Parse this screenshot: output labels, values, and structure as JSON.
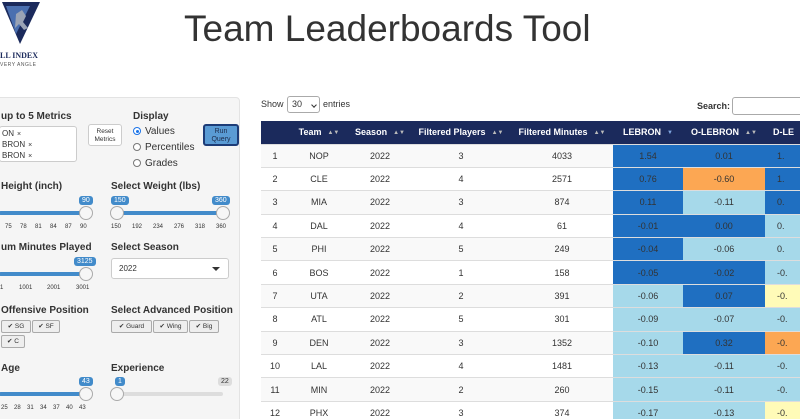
{
  "header": {
    "title": "Team Leaderboards Tool",
    "logo_title": "LL INDEX",
    "logo_subtitle": "VERY ANGLE"
  },
  "sidebar": {
    "metrics_label": "up to 5 Metrics",
    "metric_tags": [
      "ON",
      "BRON",
      "BRON"
    ],
    "remove_glyph": "×",
    "reset_label_1": "Reset",
    "reset_label_2": "Metrics",
    "display_label": "Display",
    "display_options": [
      "Values",
      "Percentiles",
      "Grades"
    ],
    "display_selected": "Values",
    "run_label_1": "Run",
    "run_label_2": "Query",
    "height_label": "Height (inch)",
    "height_max": "90",
    "height_ticks": [
      "75",
      "78",
      "81",
      "84",
      "87",
      "90"
    ],
    "weight_label": "Select Weight (lbs)",
    "weight_min": "150",
    "weight_max": "360",
    "weight_ticks": [
      "150",
      "192",
      "234",
      "276",
      "318",
      "360"
    ],
    "minutes_label": "um Minutes Played",
    "minutes_value": "3125",
    "minutes_ticks": [
      "1",
      "1001",
      "2001",
      "3001"
    ],
    "season_label": "Select Season",
    "season_value": "2022",
    "offpos_label": "Offensive Position",
    "offpos_options": [
      "SG",
      "SF",
      "C"
    ],
    "advpos_label": "Select Advanced Position",
    "advpos_options": [
      "Guard",
      "Wing",
      "Big"
    ],
    "check_glyph": "✔",
    "age_label": "Age",
    "age_max": "43",
    "age_ticks": [
      "25",
      "28",
      "31",
      "34",
      "37",
      "40",
      "43"
    ],
    "experience_label": "Experience",
    "experience_min": "1",
    "experience_max": "22"
  },
  "table_controls": {
    "show_label": "Show",
    "show_value": "30",
    "entries_label": "entries",
    "search_label": "Search:"
  },
  "colors": {
    "header_bg": "#1b2a5c",
    "dark_blue": "#1f6fc1",
    "light_blue": "#a6d9ea",
    "orange": "#fca753",
    "pale_yellow": "#fffbb8"
  },
  "table": {
    "columns": [
      "",
      "Team",
      "Season",
      "Filtered Players",
      "Filtered Minutes",
      "LEBRON",
      "O-LEBRON",
      "D-LE"
    ],
    "rows": [
      {
        "n": "1",
        "team": "NOP",
        "season": "2022",
        "players": "3",
        "minutes": "4033",
        "lebron": "1.54",
        "olebron": "0.01",
        "dlebron": "1.",
        "c1": "#1f6fc1",
        "c2": "#1f6fc1",
        "c3": "#1f6fc1"
      },
      {
        "n": "2",
        "team": "CLE",
        "season": "2022",
        "players": "4",
        "minutes": "2571",
        "lebron": "0.76",
        "olebron": "-0.60",
        "dlebron": "1.",
        "c1": "#1f6fc1",
        "c2": "#fca753",
        "c3": "#1f6fc1"
      },
      {
        "n": "3",
        "team": "MIA",
        "season": "2022",
        "players": "3",
        "minutes": "874",
        "lebron": "0.11",
        "olebron": "-0.11",
        "dlebron": "0.",
        "c1": "#1f6fc1",
        "c2": "#a6d9ea",
        "c3": "#1f6fc1"
      },
      {
        "n": "4",
        "team": "DAL",
        "season": "2022",
        "players": "4",
        "minutes": "61",
        "lebron": "-0.01",
        "olebron": "0.00",
        "dlebron": "0.",
        "c1": "#1f6fc1",
        "c2": "#1f6fc1",
        "c3": "#a6d9ea"
      },
      {
        "n": "5",
        "team": "PHI",
        "season": "2022",
        "players": "5",
        "minutes": "249",
        "lebron": "-0.04",
        "olebron": "-0.06",
        "dlebron": "0.",
        "c1": "#1f6fc1",
        "c2": "#a6d9ea",
        "c3": "#a6d9ea"
      },
      {
        "n": "6",
        "team": "BOS",
        "season": "2022",
        "players": "1",
        "minutes": "158",
        "lebron": "-0.05",
        "olebron": "-0.02",
        "dlebron": "-0.",
        "c1": "#1f6fc1",
        "c2": "#1f6fc1",
        "c3": "#a6d9ea"
      },
      {
        "n": "7",
        "team": "UTA",
        "season": "2022",
        "players": "2",
        "minutes": "391",
        "lebron": "-0.06",
        "olebron": "0.07",
        "dlebron": "-0.",
        "c1": "#a6d9ea",
        "c2": "#1f6fc1",
        "c3": "#fffbb8"
      },
      {
        "n": "8",
        "team": "ATL",
        "season": "2022",
        "players": "5",
        "minutes": "301",
        "lebron": "-0.09",
        "olebron": "-0.07",
        "dlebron": "-0.",
        "c1": "#a6d9ea",
        "c2": "#a6d9ea",
        "c3": "#a6d9ea"
      },
      {
        "n": "9",
        "team": "DEN",
        "season": "2022",
        "players": "3",
        "minutes": "1352",
        "lebron": "-0.10",
        "olebron": "0.32",
        "dlebron": "-0.",
        "c1": "#a6d9ea",
        "c2": "#1f6fc1",
        "c3": "#fca753"
      },
      {
        "n": "10",
        "team": "LAL",
        "season": "2022",
        "players": "4",
        "minutes": "1481",
        "lebron": "-0.13",
        "olebron": "-0.11",
        "dlebron": "-0.",
        "c1": "#a6d9ea",
        "c2": "#a6d9ea",
        "c3": "#a6d9ea"
      },
      {
        "n": "11",
        "team": "MIN",
        "season": "2022",
        "players": "2",
        "minutes": "260",
        "lebron": "-0.15",
        "olebron": "-0.11",
        "dlebron": "-0.",
        "c1": "#a6d9ea",
        "c2": "#a6d9ea",
        "c3": "#a6d9ea"
      },
      {
        "n": "12",
        "team": "PHX",
        "season": "2022",
        "players": "3",
        "minutes": "374",
        "lebron": "-0.17",
        "olebron": "-0.13",
        "dlebron": "-0.",
        "c1": "#a6d9ea",
        "c2": "#a6d9ea",
        "c3": "#fffbb8"
      }
    ]
  }
}
